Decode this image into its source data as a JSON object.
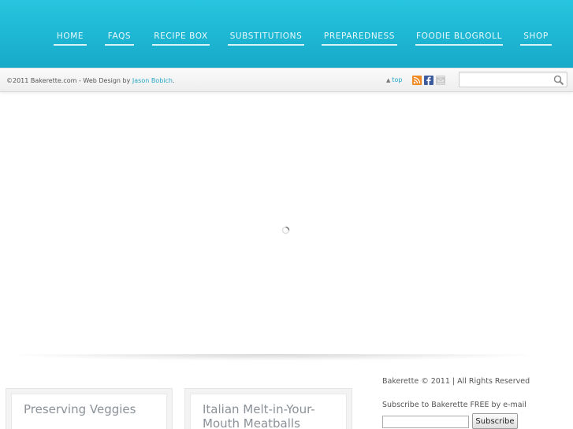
{
  "nav": {
    "items": [
      {
        "label": "HOME"
      },
      {
        "label": "FAQS"
      },
      {
        "label": "RECIPE BOX"
      },
      {
        "label": "SUBSTITUTIONS"
      },
      {
        "label": "PREPAREDNESS"
      },
      {
        "label": "FOODIE BLOGROLL"
      },
      {
        "label": "SHOP"
      }
    ]
  },
  "strip": {
    "copyright_prefix": "©2011 Bakerette.com - Web Design by ",
    "designer_link": "Jason Bobich",
    "copyright_suffix": ".",
    "top_link": "top",
    "search_placeholder": ""
  },
  "posts": [
    {
      "title": "Preserving Veggies"
    },
    {
      "title": "Italian Melt-in-Your-Mouth Meatballs"
    }
  ],
  "sidebar": {
    "rights": "Bakerette © 2011 | All Rights Reserved",
    "subscribe_label": "Subscribe to Bakerette FREE by e-mail",
    "email_value": "",
    "subscribe_button": "Subscribe"
  },
  "colors": {
    "accent": "#1db6d3",
    "link": "#27a7c7",
    "rss": "#f08a24",
    "facebook": "#3b5b9c"
  },
  "icons": {
    "rss": "rss-icon",
    "facebook": "facebook-icon",
    "email": "email-icon",
    "search": "search-icon",
    "loading": "loading-spinner-icon",
    "top_arrow": "up-arrow-icon"
  }
}
